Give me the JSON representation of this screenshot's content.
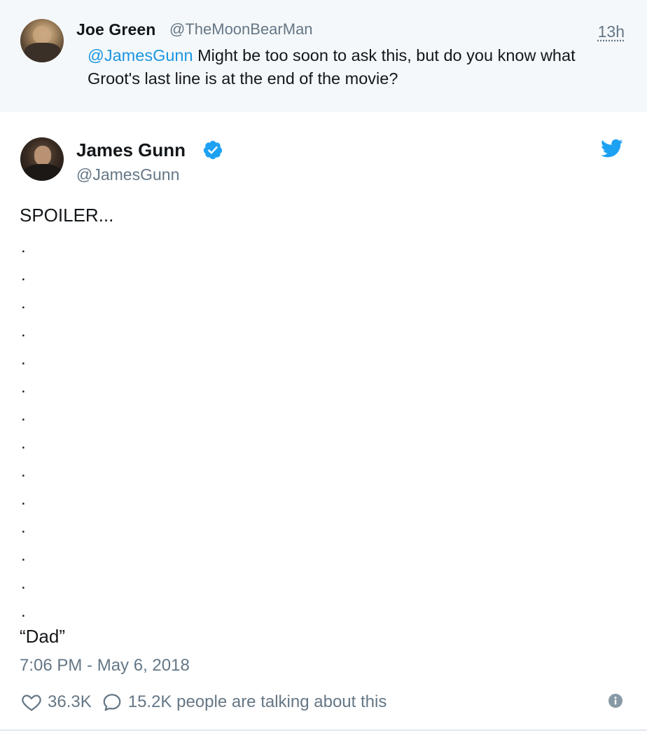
{
  "parent_tweet": {
    "name": "Joe Green",
    "handle": "@TheMoonBearMan",
    "time": "13h",
    "mention": "@JamesGunn",
    "text": " Might be too soon to ask this, but do you know what Groot's last line is at the end of the movie?"
  },
  "tweet": {
    "name": "James Gunn",
    "handle": "@JamesGunn",
    "verified_icon": "verified-badge-icon",
    "logo_icon": "twitter-bird-icon",
    "line1": "SPOILER...",
    "dots": [
      ".",
      ".",
      ".",
      ".",
      ".",
      ".",
      ".",
      ".",
      ".",
      ".",
      ".",
      ".",
      ".",
      "."
    ],
    "quote": "“Dad”",
    "timestamp": "7:06 PM - May 6, 2018"
  },
  "actions": {
    "like_count": "36.3K",
    "talking_text": "15.2K people are talking about this",
    "icons": [
      "heart-icon",
      "reply-bubble-icon",
      "info-icon"
    ]
  },
  "colors": {
    "accent": "#1da1f2",
    "link": "#1b95e0",
    "muted": "#657786",
    "text": "#14171a",
    "parent_bg": "#f5f8fa"
  }
}
